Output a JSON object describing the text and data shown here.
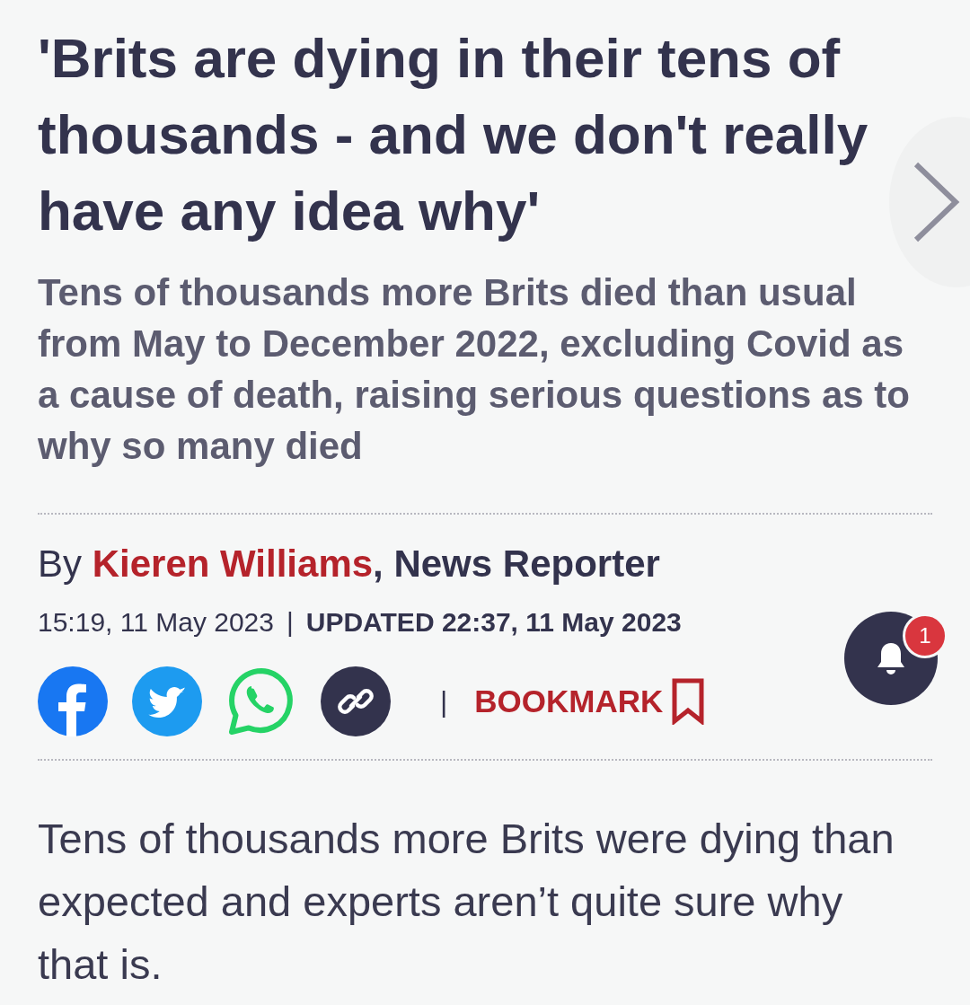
{
  "headline": "'Brits are dying in their tens of thousands - and we don't really have any idea why'",
  "standfirst": "Tens of thousands more Brits died than usual from May to December 2022, excluding Covid as a cause of death, raising serious questions as to why so many died",
  "byline": {
    "prefix": "By",
    "author": "Kieren Williams",
    "suffix": ", News Reporter"
  },
  "dates": {
    "published": "15:19, 11 May 2023",
    "divider": "|",
    "updated_label": "UPDATED",
    "updated": "22:37, 11 May 2023"
  },
  "share": [
    {
      "kind": "facebook"
    },
    {
      "kind": "twitter"
    },
    {
      "kind": "whatsapp"
    },
    {
      "kind": "link"
    }
  ],
  "share_divider": "|",
  "bookmark": "BOOKMARK",
  "notifications": {
    "count": "1"
  },
  "body": "Tens of thousands more Brits were dying than expected and experts aren’t quite sure why that is."
}
